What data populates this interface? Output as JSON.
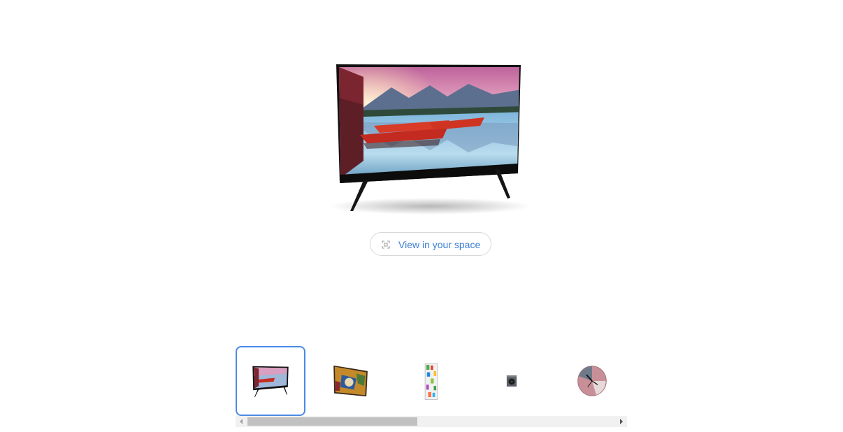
{
  "viewer": {
    "model_name": "tv",
    "ar_button": {
      "label": "View in your space",
      "icon": "ar-view-icon"
    }
  },
  "thumbnails": [
    {
      "name": "tv",
      "icon": "tv-thumbnail",
      "selected": true
    },
    {
      "name": "painting",
      "icon": "painting-thumbnail",
      "selected": false
    },
    {
      "name": "bookshelf",
      "icon": "bookshelf-thumbnail",
      "selected": false
    },
    {
      "name": "speaker",
      "icon": "speaker-thumbnail",
      "selected": false
    },
    {
      "name": "clock",
      "icon": "clock-thumbnail",
      "selected": false
    }
  ],
  "scrollbar": {
    "position_fraction": 0.0,
    "visible_fraction": 0.46
  },
  "colors": {
    "accent": "#3b7fd4",
    "selected_border": "#4a8ae6",
    "scrollbar_track": "#f1f1f1",
    "scrollbar_thumb": "#c1c1c1"
  }
}
